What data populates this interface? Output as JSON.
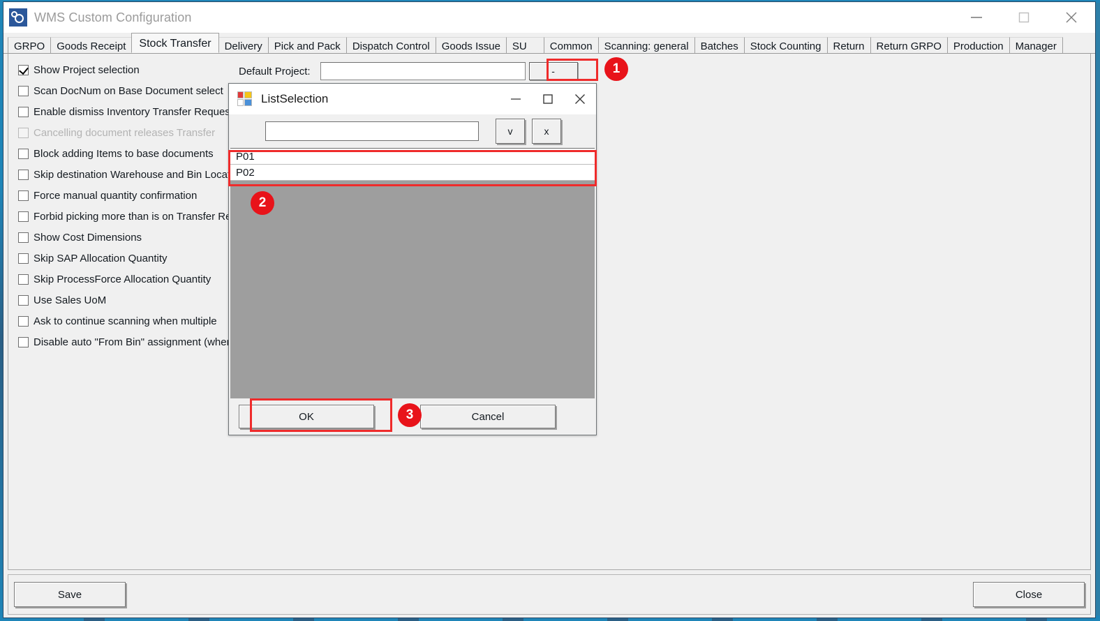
{
  "window": {
    "title": "WMS Custom Configuration",
    "icon": "gears-icon",
    "minimize": "—",
    "maximize": "□",
    "close": "✕"
  },
  "tabs": [
    {
      "label": "GRPO",
      "active": false
    },
    {
      "label": "Goods Receipt",
      "active": false
    },
    {
      "label": "Stock Transfer",
      "active": true
    },
    {
      "label": "Delivery",
      "active": false
    },
    {
      "label": "Pick and Pack",
      "active": false
    },
    {
      "label": "Dispatch Control",
      "active": false
    },
    {
      "label": "Goods Issue",
      "active": false
    },
    {
      "label": "SU",
      "active": false
    },
    {
      "label": "Common",
      "active": false
    },
    {
      "label": "Scanning: general",
      "active": false
    },
    {
      "label": "Batches",
      "active": false
    },
    {
      "label": "Stock Counting",
      "active": false
    },
    {
      "label": "Return",
      "active": false
    },
    {
      "label": "Return GRPO",
      "active": false
    },
    {
      "label": "Production",
      "active": false
    },
    {
      "label": "Manager",
      "active": false
    }
  ],
  "options": [
    {
      "label": "Show Project selection",
      "checked": true,
      "disabled": false
    },
    {
      "label": "Scan DocNum on Base Document select",
      "checked": false,
      "disabled": false
    },
    {
      "label": "Enable dismiss Inventory Transfer Request",
      "checked": false,
      "disabled": false
    },
    {
      "label": "Cancelling document releases Transfer",
      "checked": false,
      "disabled": true
    },
    {
      "label": "Block adding Items to base documents",
      "checked": false,
      "disabled": false
    },
    {
      "label": "Skip destination Warehouse and Bin Location",
      "checked": false,
      "disabled": false
    },
    {
      "label": "Force manual quantity confirmation",
      "checked": false,
      "disabled": false
    },
    {
      "label": "Forbid picking more than is on Transfer Request",
      "checked": false,
      "disabled": false
    },
    {
      "label": "Show Cost Dimensions",
      "checked": false,
      "disabled": false
    },
    {
      "label": "Skip SAP Allocation Quantity",
      "checked": false,
      "disabled": false
    },
    {
      "label": "Skip ProcessForce Allocation Quantity",
      "checked": false,
      "disabled": false
    },
    {
      "label": "Use Sales UoM",
      "checked": false,
      "disabled": false
    },
    {
      "label": "Ask to continue scanning when multiple",
      "checked": false,
      "disabled": false
    },
    {
      "label": "Disable auto \"From Bin\" assignment (when",
      "checked": false,
      "disabled": false
    }
  ],
  "default_project": {
    "label": "Default Project:",
    "value": "",
    "placeholder": "",
    "browse_button": "-"
  },
  "footer": {
    "save_label": "Save",
    "close_label": "Close"
  },
  "dialog": {
    "title": "ListSelection",
    "icon": "colored-squares-icon",
    "minimize": "—",
    "maximize": "□",
    "close": "✕",
    "search_value": "",
    "search_placeholder": "",
    "confirm_button": "v",
    "clear_button": "x",
    "items": [
      "P01",
      "P02"
    ],
    "ok_label": "OK",
    "cancel_label": "Cancel"
  },
  "annotations": {
    "accent_color": "#e8131a",
    "markers": [
      {
        "number": "1",
        "target": "default-project-browse-button"
      },
      {
        "number": "2",
        "target": "listselection-items"
      },
      {
        "number": "3",
        "target": "listselection-ok-button"
      }
    ]
  }
}
